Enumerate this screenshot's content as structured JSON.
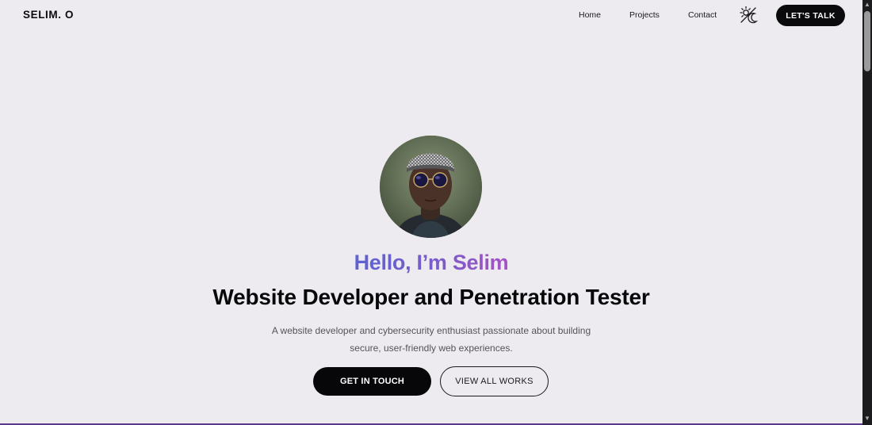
{
  "header": {
    "logo": "SELIM. O",
    "nav": [
      "Home",
      "Projects",
      "Contact"
    ],
    "theme_icon": "sun-moon-icon",
    "cta": "LET'S TALK"
  },
  "hero": {
    "avatar_icon": "profile-photo",
    "greeting": "Hello, I’m Selim",
    "headline": "Website Developer and Penetration Tester",
    "description_line1": "A website developer and cybersecurity enthusiast passionate about building",
    "description_line2": "secure, user-friendly web experiences.",
    "primary_button": "GET IN TOUCH",
    "secondary_button": "VIEW ALL WORKS"
  },
  "colors": {
    "background": "#edebef",
    "accent_gradient_start": "#5d63d0",
    "accent_gradient_end": "#a552c4",
    "button_dark": "#07070a"
  }
}
